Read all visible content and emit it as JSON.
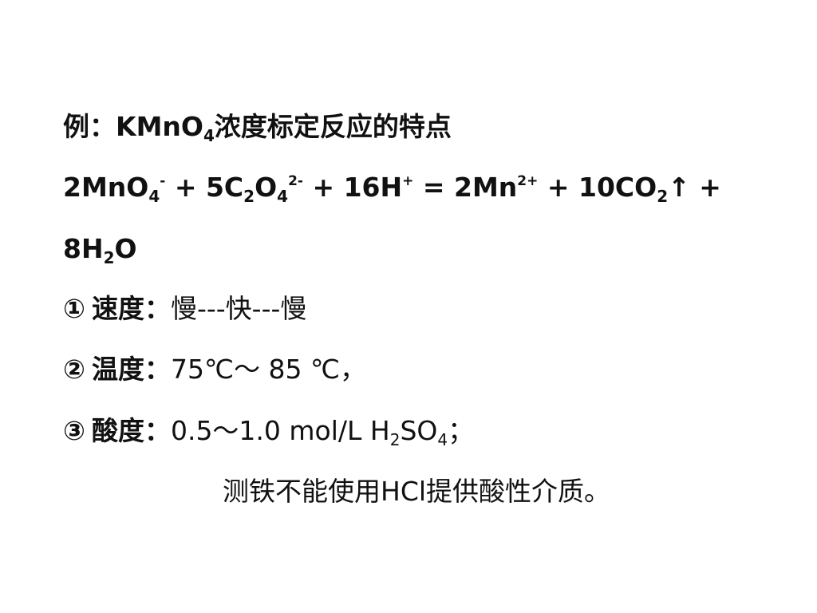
{
  "title": {
    "prefix": "例：KMnO",
    "sub": "4",
    "rest": "浓度标定反应的特点"
  },
  "equation": {
    "t1": "2MnO",
    "t1_sub": "4",
    "t1_sup": "-",
    "t2": " + 5C",
    "t2_sub1": "2",
    "t2_mid": "O",
    "t2_sub2": "4",
    "t2_sup": "2-",
    "t3": " + 16H",
    "t3_sup": "+",
    "t4": " = 2Mn",
    "t4_sup": "2+",
    "t5": " + 10CO",
    "t5_sub": "2",
    "t5_arrow": "↑ +",
    "line2_a": "8H",
    "line2_sub": "2",
    "line2_b": "O"
  },
  "items": [
    {
      "marker": "①",
      "label": "速度：",
      "value": "慢---快---慢"
    },
    {
      "marker": "②",
      "label": "温度：",
      "value": "75℃～ 85 ℃，"
    },
    {
      "marker": "③",
      "label": "酸度：",
      "value_a": "0.5～1.0 mol/L H",
      "value_sub1": "2",
      "value_b": "SO",
      "value_sub2": "4",
      "value_c": "；"
    }
  ],
  "note": "测铁不能使用HCl提供酸性介质。"
}
